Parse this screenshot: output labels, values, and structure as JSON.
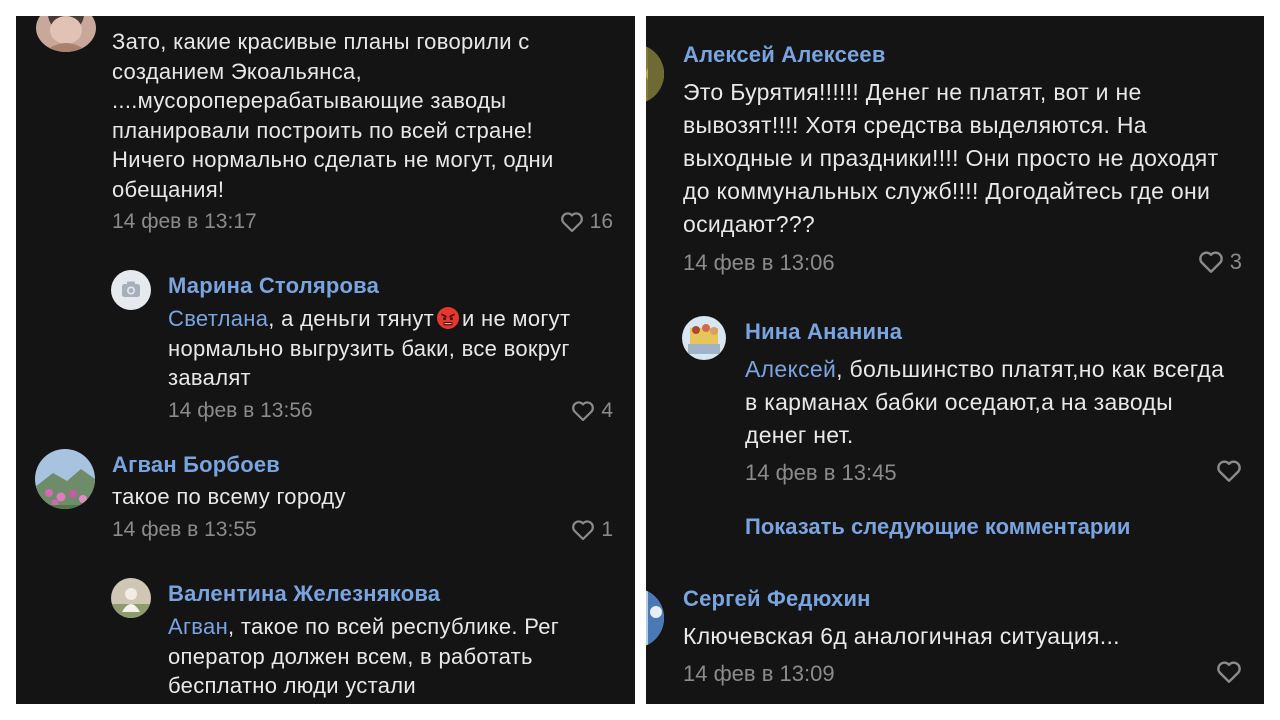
{
  "left": {
    "comment1": {
      "text": "Зато, какие красивые планы говорили с созданием Экоальянса, ....мусороперерабатывающие заводы планировали построить по всей стране! Ничего нормально сделать не могут, одни обещания!",
      "date": "14 фев в 13:17",
      "likes": "16"
    },
    "reply1": {
      "author": "Марина Столярова",
      "mention": "Светлана",
      "text_before_emoji": ", а деньги тянут",
      "emoji": "angry-face-emoji",
      "text_after_emoji": "и не могут нормально выгрузить баки, все вокруг завалят",
      "date": "14 фев в 13:56",
      "likes": "4"
    },
    "comment2": {
      "author": "Агван Борбоев",
      "text": "такое по всему городу",
      "date": "14 фев в 13:55",
      "likes": "1"
    },
    "reply2": {
      "author": "Валентина Железнякова",
      "mention": "Агван",
      "text": ", такое по всей республике. Рег оператор должен всем, в работать бесплатно люди устали"
    }
  },
  "right": {
    "comment1": {
      "author": "Алексей Алексеев",
      "text": "Это Бурятия!!!!!! Денег не платят, вот и не вывозят!!!! Хотя средства выделяются. На выходные и праздники!!!! Они просто не доходят до коммунальных служб!!!! Догодайтесь где они осидают???",
      "date": "14 фев в 13:06",
      "likes": "3"
    },
    "reply1": {
      "author": "Нина Ананина",
      "mention": "Алексей",
      "text": ", большинство платят,но как всегда в карманах бабки оседают,а на заводы денег нет.",
      "date": "14 фев в 13:45"
    },
    "show_more_label": "Показать следующие комментарии",
    "comment2": {
      "author": "Сергей Федюхин",
      "text": "Ключевская 6д аналогичная ситуация...",
      "date": "14 фев в 13:09"
    }
  },
  "colors": {
    "background": "#141414",
    "name": "#7aa4e0",
    "text": "#e8e8e8",
    "meta": "#8b8b8b"
  },
  "icons": {
    "like": "heart-outline-icon",
    "camera": "camera-icon"
  }
}
